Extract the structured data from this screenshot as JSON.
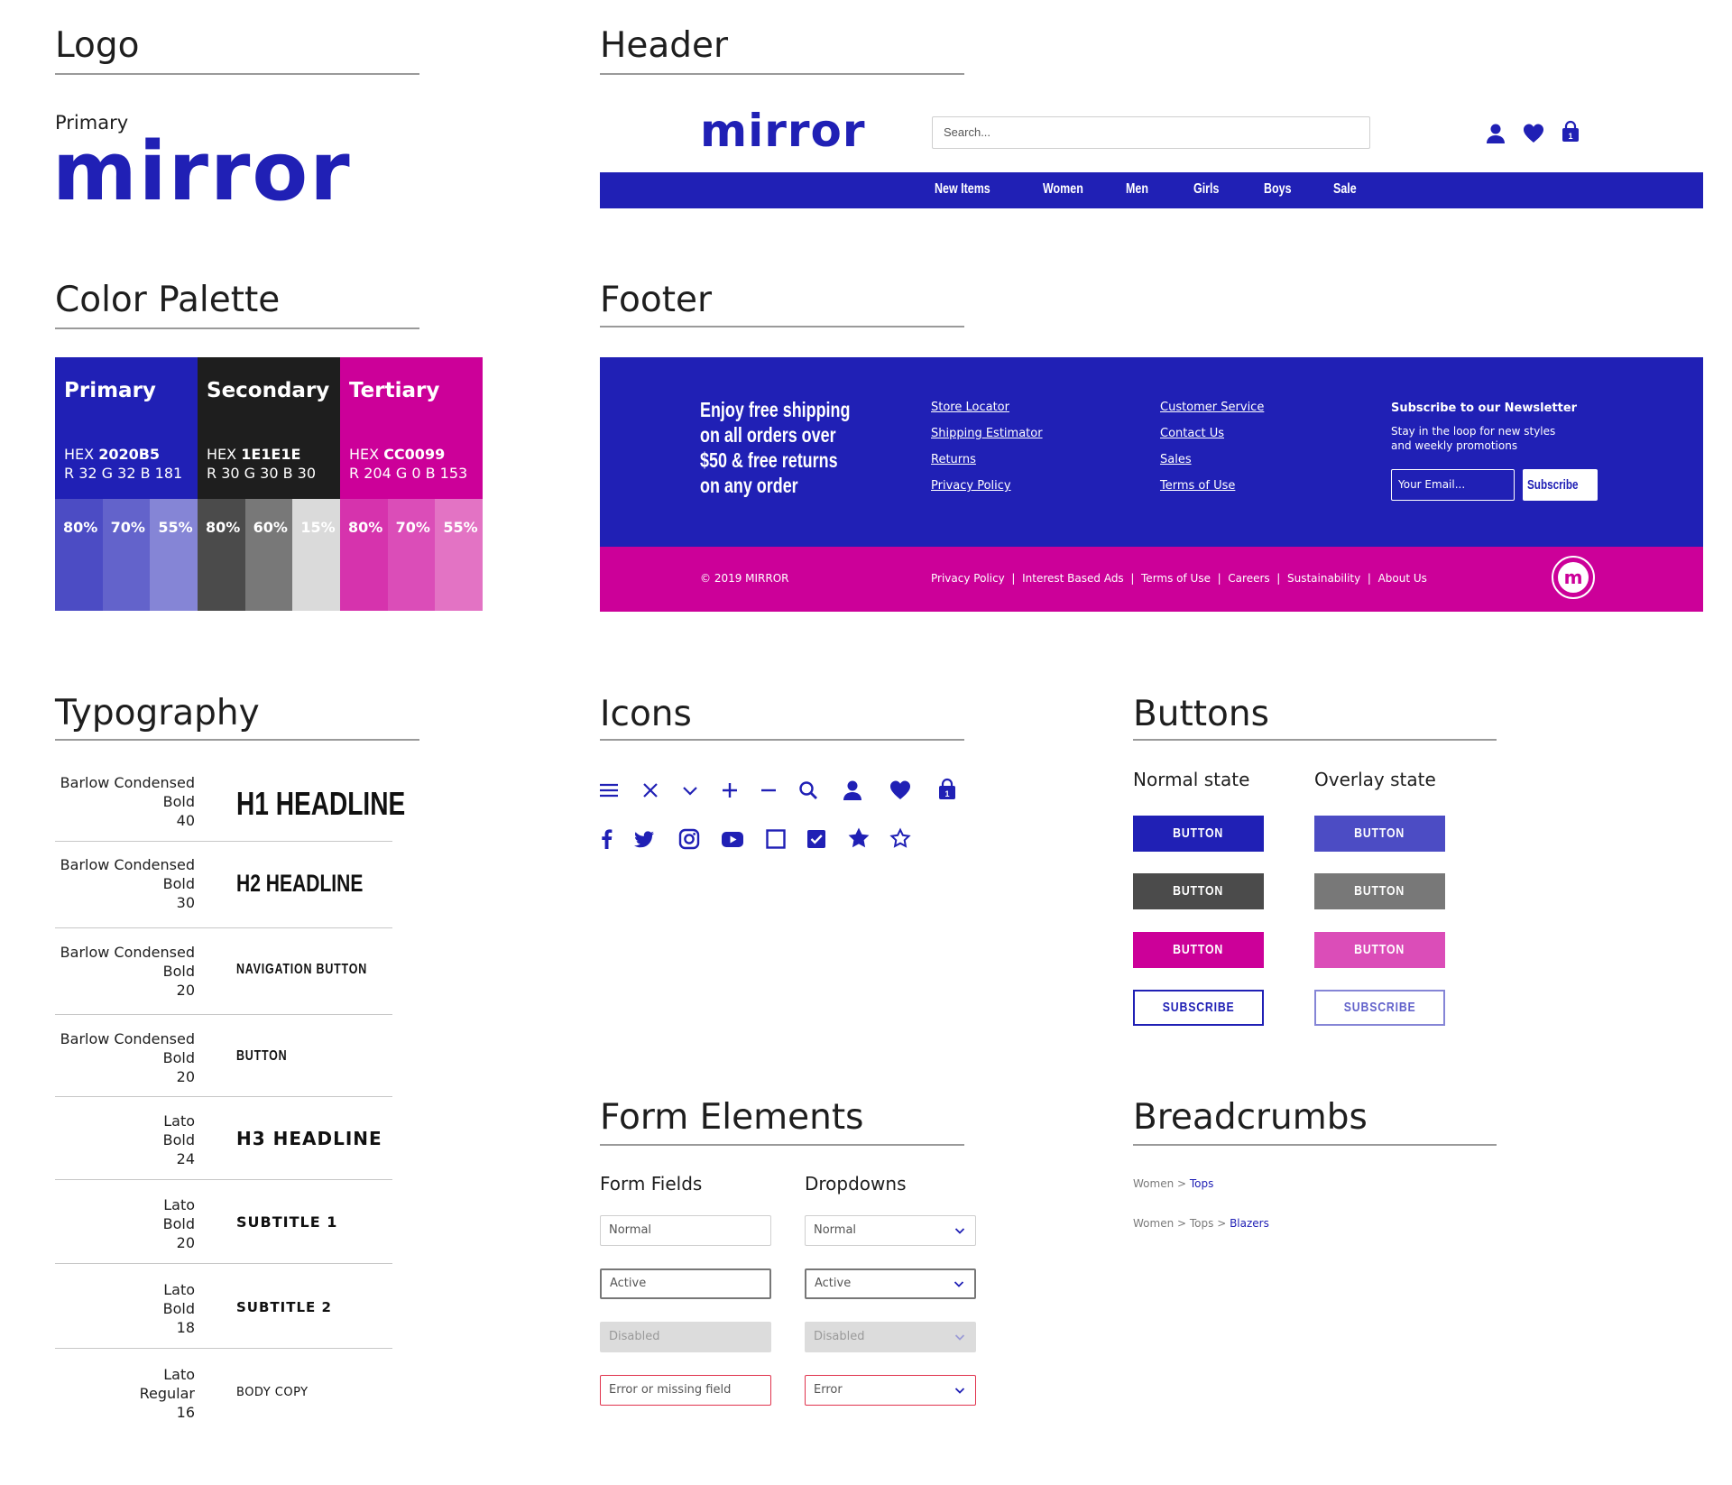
{
  "sections": {
    "logo": "Logo",
    "header": "Header",
    "palette": "Color Palette",
    "footer": "Footer",
    "typography": "Typography",
    "icons": "Icons",
    "buttons": "Buttons",
    "forms": "Form Elements",
    "breadcrumbs": "Breadcrumbs"
  },
  "logo": {
    "label": "Primary",
    "wordmark": "mirror"
  },
  "palette": [
    {
      "name": "Primary",
      "hex_label": "HEX",
      "hex": "2020B5",
      "rgb": "R 32 G 32 B 181",
      "color": "#2020b5",
      "tints": [
        {
          "label": "80%",
          "color": "#4c4cc4"
        },
        {
          "label": "70%",
          "color": "#6363cb"
        },
        {
          "label": "55%",
          "color": "#8585d6"
        }
      ]
    },
    {
      "name": "Secondary",
      "hex_label": "HEX",
      "hex": "1E1E1E",
      "rgb": "R 30 G 30 B 30",
      "color": "#1e1e1e",
      "tints": [
        {
          "label": "80%",
          "color": "#4b4b4b"
        },
        {
          "label": "60%",
          "color": "#787878"
        },
        {
          "label": "15%",
          "color": "#dadada"
        }
      ]
    },
    {
      "name": "Tertiary",
      "hex_label": "HEX",
      "hex": "CC0099",
      "rgb": "R 204 G 0 B 153",
      "color": "#cc0099",
      "tints": [
        {
          "label": "80%",
          "color": "#d633ad"
        },
        {
          "label": "70%",
          "color": "#db4db8"
        },
        {
          "label": "55%",
          "color": "#e373c4"
        }
      ]
    }
  ],
  "header": {
    "logo": "mirror",
    "search_placeholder": "Search...",
    "cart_count": "1",
    "nav": [
      "New Items",
      "Women",
      "Men",
      "Girls",
      "Boys",
      "Sale"
    ]
  },
  "footer": {
    "promo": [
      "Enjoy free shipping",
      "on all orders over",
      "$50 & free returns",
      "on any order"
    ],
    "links_col1": [
      "Store Locator",
      "Shipping Estimator",
      "Returns",
      "Privacy Policy"
    ],
    "links_col2": [
      "Customer Service",
      "Contact Us",
      "Sales",
      "Terms of Use"
    ],
    "newsletter_title": "Subscribe to our Newsletter",
    "newsletter_text": [
      "Stay in the loop for new styles",
      "and weekly promotions"
    ],
    "email_placeholder": "Your Email...",
    "subscribe": "Subscribe",
    "copyright": "© 2019 MIRROR",
    "legal": [
      "Privacy Policy",
      "Interest Based Ads",
      "Terms of Use",
      "Careers",
      "Sustainability",
      "About Us"
    ],
    "badge_letter": "m"
  },
  "typography": [
    {
      "font": "Barlow Condensed",
      "weight": "Bold",
      "size": "40",
      "sample": "H1 HEADLINE"
    },
    {
      "font": "Barlow Condensed",
      "weight": "Bold",
      "size": "30",
      "sample": "H2 HEADLINE"
    },
    {
      "font": "Barlow Condensed",
      "weight": "Bold",
      "size": "20",
      "sample": "NAVIGATION BUTTON"
    },
    {
      "font": "Barlow Condensed",
      "weight": "Bold",
      "size": "20",
      "sample": "BUTTON"
    },
    {
      "font": "Lato",
      "weight": "Bold",
      "size": "24",
      "sample": "H3 HEADLINE"
    },
    {
      "font": "Lato",
      "weight": "Bold",
      "size": "20",
      "sample": "SUBTITLE 1"
    },
    {
      "font": "Lato",
      "weight": "Bold",
      "size": "18",
      "sample": "SUBTITLE 2"
    },
    {
      "font": "Lato",
      "weight": "Regular",
      "size": "16",
      "sample": "BODY COPY"
    }
  ],
  "icons": {
    "row1": [
      "menu-icon",
      "close-icon",
      "chevron-down-icon",
      "plus-icon",
      "minus-icon",
      "search-icon",
      "user-icon",
      "heart-icon",
      "bag-icon"
    ],
    "row2": [
      "facebook-icon",
      "twitter-icon",
      "instagram-icon",
      "youtube-icon",
      "checkbox-empty-icon",
      "checkbox-checked-icon",
      "star-filled-icon",
      "star-outline-icon"
    ],
    "bag_count": "1"
  },
  "buttons": {
    "normal_label": "Normal state",
    "overlay_label": "Overlay state",
    "button_text": "BUTTON",
    "subscribe_text": "SUBSCRIBE",
    "colors": {
      "primary": "#2020b5",
      "primary_overlay": "#4c4cc4",
      "secondary": "#4b4b4b",
      "secondary_overlay": "#787878",
      "tertiary": "#cc0099",
      "tertiary_overlay": "#db4db8"
    }
  },
  "forms": {
    "fields_label": "Form Fields",
    "dropdowns_label": "Dropdowns",
    "fields": [
      "Normal",
      "Active",
      "Disabled",
      "Error or missing field"
    ],
    "dropdowns": [
      "Normal",
      "Active",
      "Disabled",
      "Error"
    ]
  },
  "breadcrumbs": [
    {
      "trail": [
        "Women"
      ],
      "current": "Tops"
    },
    {
      "trail": [
        "Women",
        "Tops"
      ],
      "current": "Blazers"
    }
  ]
}
